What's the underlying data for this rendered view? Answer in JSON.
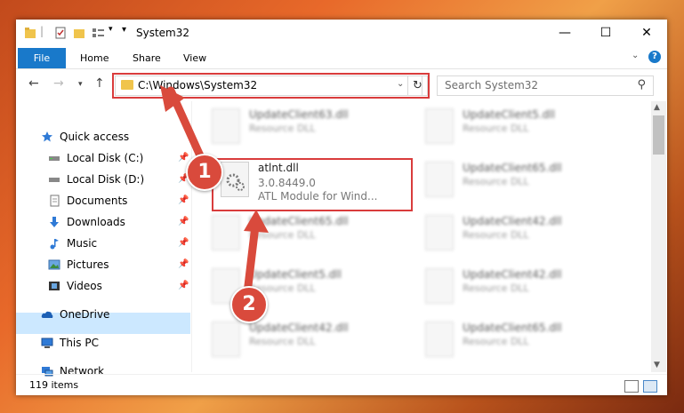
{
  "window": {
    "title": "System32",
    "controls": {
      "minimize": "—",
      "maximize": "☐",
      "close": "✕"
    }
  },
  "ribbon": {
    "tabs": [
      "File",
      "Home",
      "Share",
      "View"
    ]
  },
  "address": {
    "path": "C:\\Windows\\System32",
    "search_placeholder": "Search System32"
  },
  "nav": {
    "items": [
      {
        "label": "Quick access",
        "icon": "star-icon",
        "pinned": false
      },
      {
        "label": "Local Disk (C:)",
        "icon": "drive-icon",
        "pinned": true
      },
      {
        "label": "Local Disk (D:)",
        "icon": "drive-icon",
        "pinned": true
      },
      {
        "label": "Documents",
        "icon": "documents-icon",
        "pinned": true
      },
      {
        "label": "Downloads",
        "icon": "downloads-icon",
        "pinned": true
      },
      {
        "label": "Music",
        "icon": "music-icon",
        "pinned": true
      },
      {
        "label": "Pictures",
        "icon": "pictures-icon",
        "pinned": true
      },
      {
        "label": "Videos",
        "icon": "videos-icon",
        "pinned": true
      },
      {
        "label": "OneDrive",
        "icon": "cloud-icon",
        "pinned": false
      },
      {
        "label": "This PC",
        "icon": "computer-icon",
        "pinned": false,
        "selected": true
      },
      {
        "label": "Network",
        "icon": "network-icon",
        "pinned": false
      }
    ]
  },
  "files": {
    "highlighted": {
      "name": "atlnt.dll",
      "version": "3.0.8449.0",
      "description": "ATL Module for Wind..."
    },
    "left_col": [
      {
        "name": "UpdateClient63.dll",
        "type": "Resource DLL"
      },
      {
        "name": "UpdateClient65.dll",
        "type": "Resource DLL"
      },
      {
        "name": "UpdateClient5.dll",
        "type": "Resource DLL"
      },
      {
        "name": "UpdateClient42.dll",
        "type": "Resource DLL"
      }
    ],
    "right_col": [
      {
        "name": "UpdateClient5.dll",
        "type": "Resource DLL"
      },
      {
        "name": "UpdateClient65.dll",
        "type": "Resource DLL"
      },
      {
        "name": "UpdateClient42.dll",
        "type": "Resource DLL"
      },
      {
        "name": "UpdateClient42.dll",
        "type": "Resource DLL"
      },
      {
        "name": "UpdateClient65.dll",
        "type": "Resource DLL"
      }
    ]
  },
  "status": {
    "item_count": "119 items"
  },
  "callouts": {
    "one": "1",
    "two": "2"
  },
  "colors": {
    "accent": "#1979ca",
    "highlight": "#d93c3c",
    "selected_bg": "#cce8ff"
  }
}
